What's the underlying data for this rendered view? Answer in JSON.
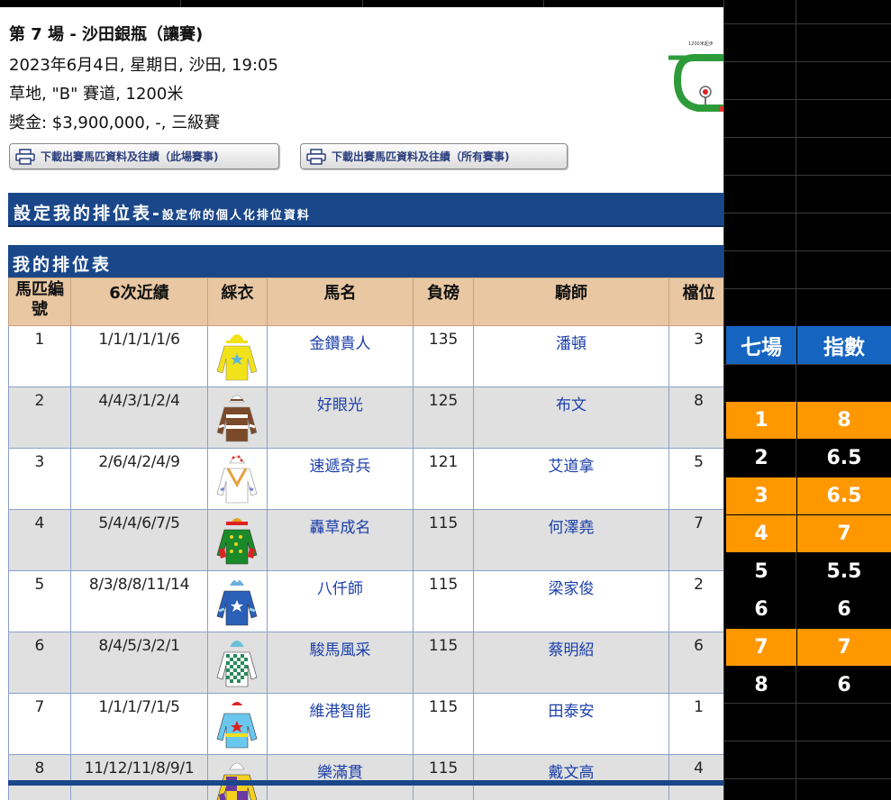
{
  "race": {
    "title": "第 7 場 - 沙田銀瓶（讓賽)",
    "datetime": "2023年6月4日, 星期日, 沙田, 19:05",
    "track": "草地, \"B\" 賽道, 1200米",
    "prize": "獎金: $3,900,000, -, 三級賽",
    "map_label": "1200米起步"
  },
  "buttons": {
    "download_this": "下載出賽馬匹資料及往績（此場賽事)",
    "download_all": "下載出賽馬匹資料及往績（所有賽事)"
  },
  "bars": {
    "settings_title": "設定我的排位表-",
    "settings_sub": "設定你的個人化排位資料",
    "my_table": "我的排位表"
  },
  "table": {
    "headers": [
      "馬匹編號",
      "6次近績",
      "綵衣",
      "馬名",
      "負磅",
      "騎師",
      "檔位"
    ],
    "rows": [
      {
        "no": "1",
        "form": "1/1/1/1/1/6",
        "name": "金鑽貴人",
        "weight": "135",
        "jockey": "潘頓",
        "draw": "3",
        "silk": "yellow-blue-star"
      },
      {
        "no": "2",
        "form": "4/4/3/1/2/4",
        "name": "好眼光",
        "weight": "125",
        "jockey": "布文",
        "draw": "8",
        "silk": "brown-white-hoops"
      },
      {
        "no": "3",
        "form": "2/6/4/2/4/9",
        "name": "速遞奇兵",
        "weight": "121",
        "jockey": "艾道拿",
        "draw": "5",
        "silk": "white-orange-v"
      },
      {
        "no": "4",
        "form": "5/4/4/6/7/5",
        "name": "轟草成名",
        "weight": "115",
        "jockey": "何澤堯",
        "draw": "7",
        "silk": "green-red-dots"
      },
      {
        "no": "5",
        "form": "8/3/8/8/11/14",
        "name": "八仟師",
        "weight": "115",
        "jockey": "梁家俊",
        "draw": "2",
        "silk": "blue-white-star"
      },
      {
        "no": "6",
        "form": "8/4/5/3/2/1",
        "name": "駿馬風采",
        "weight": "115",
        "jockey": "蔡明紹",
        "draw": "6",
        "silk": "green-white-check"
      },
      {
        "no": "7",
        "form": "1/1/1/7/1/5",
        "name": "維港智能",
        "weight": "115",
        "jockey": "田泰安",
        "draw": "1",
        "silk": "lightblue-red-star"
      },
      {
        "no": "8",
        "form": "11/12/11/8/9/1",
        "name": "樂滿貫",
        "weight": "115",
        "jockey": "戴文高",
        "draw": "4",
        "silk": "purple-yellow-quarters"
      }
    ]
  },
  "sheet": {
    "col1_header": "七場",
    "col2_header": "指數",
    "rows": [
      {
        "race": "1",
        "index": "8",
        "highlight": true
      },
      {
        "race": "2",
        "index": "6.5",
        "highlight": false
      },
      {
        "race": "3",
        "index": "6.5",
        "highlight": true
      },
      {
        "race": "4",
        "index": "7",
        "highlight": true
      },
      {
        "race": "5",
        "index": "5.5",
        "highlight": false
      },
      {
        "race": "6",
        "index": "6",
        "highlight": false
      },
      {
        "race": "7",
        "index": "7",
        "highlight": true
      },
      {
        "race": "8",
        "index": "6",
        "highlight": false
      }
    ],
    "highlight_color": "#ff9800",
    "header_color": "#1565c0"
  }
}
